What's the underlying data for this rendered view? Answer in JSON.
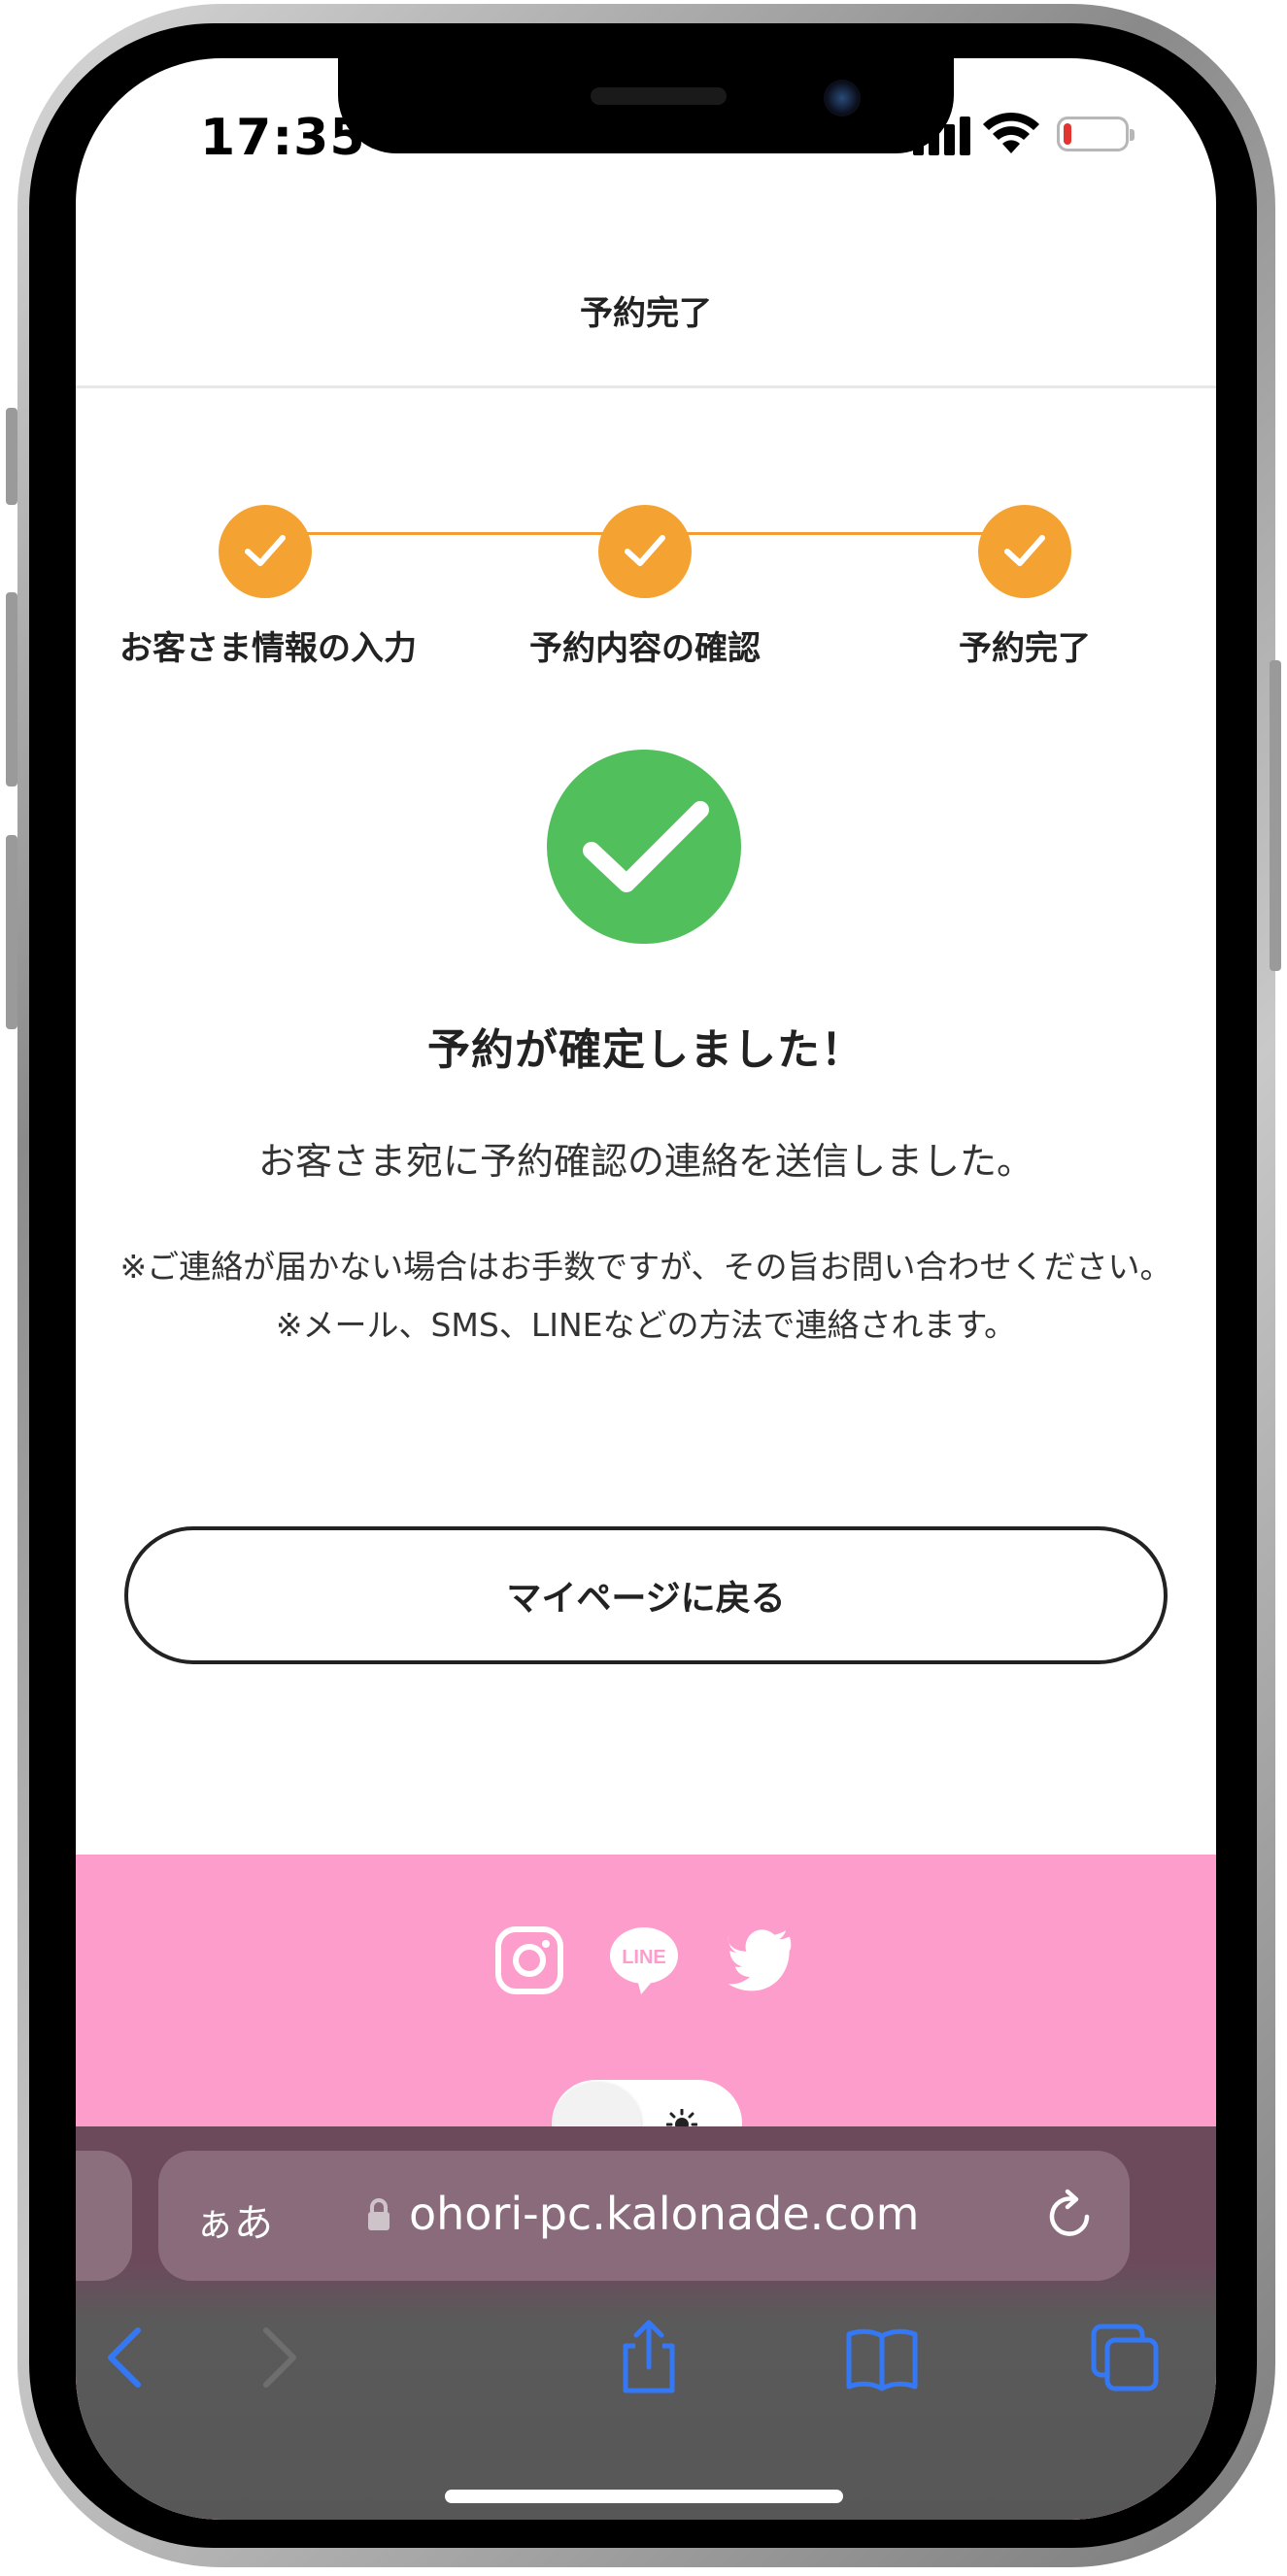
{
  "status_bar": {
    "time": "17:35"
  },
  "header": {
    "title": "予約完了"
  },
  "steps": [
    {
      "label": "お客さま情報の入力"
    },
    {
      "label": "予約内容の確認"
    },
    {
      "label": "予約完了"
    }
  ],
  "confirmation": {
    "title": "予約が確定しました！",
    "message": "お客さま宛に予約確認の連絡を送信しました。",
    "note_line1": "※ご連絡が届かない場合はお手数ですが、その旨お問い合わせください。",
    "note_line2": "※メール、SMS、LINEなどの方法で連絡されます。"
  },
  "mypage_button": {
    "label": "マイページに戻る"
  },
  "footer": {
    "social": [
      {
        "icon": "instagram-icon"
      },
      {
        "icon": "line-icon",
        "label": "LINE"
      },
      {
        "icon": "twitter-icon"
      }
    ],
    "theme_toggle": {
      "icon": "sun-icon"
    }
  },
  "browser": {
    "aa_label": "ぁあ",
    "url": "ohori-pc.kalonade.com"
  },
  "colors": {
    "step_orange": "#f4a332",
    "success_green": "#51bf5b",
    "footer_pink": "#fd9dcc",
    "ios_blue": "#3478f6"
  }
}
